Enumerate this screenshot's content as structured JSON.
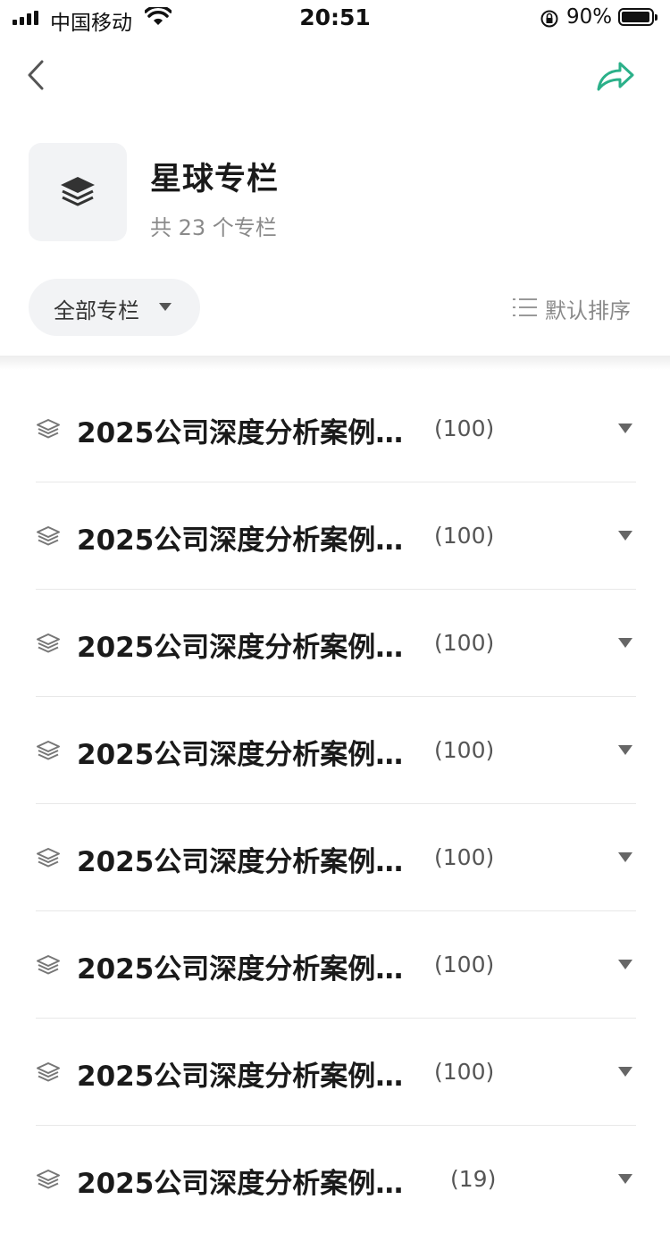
{
  "status_bar": {
    "carrier": "中国移动",
    "time": "20:51",
    "battery": "90%"
  },
  "nav": {
    "back_icon": "chevron-left-icon",
    "share_icon": "share-arrow-icon",
    "share_color": "#2bb089"
  },
  "header": {
    "icon": "layers-icon",
    "title": "星球专栏",
    "subtitle": "共 23 个专栏"
  },
  "filter": {
    "label": "全部专栏",
    "sort_label": "默认排序"
  },
  "columns": [
    {
      "title": "2025公司深度分析案例…",
      "count": "(100)"
    },
    {
      "title": "2025公司深度分析案例…",
      "count": "(100)"
    },
    {
      "title": "2025公司深度分析案例…",
      "count": "(100)"
    },
    {
      "title": "2025公司深度分析案例…",
      "count": "(100)"
    },
    {
      "title": "2025公司深度分析案例…",
      "count": "(100)"
    },
    {
      "title": "2025公司深度分析案例…",
      "count": "(100)"
    },
    {
      "title": "2025公司深度分析案例…",
      "count": "(100)"
    },
    {
      "title": "2025公司深度分析案例…",
      "count": "(19)"
    }
  ]
}
